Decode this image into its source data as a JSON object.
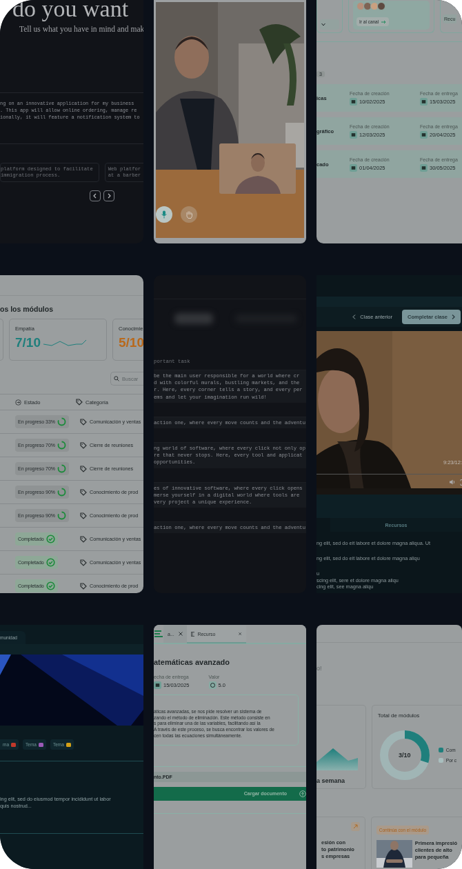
{
  "idea_panel": {
    "heading": "do you want",
    "subtitle": "Tell us what you have in mind and mak",
    "prompt_lines": [
      "ng on an innovative application for my business",
      ". This app will allow online ordering, manage re",
      "ionally, it will feature a notification system to"
    ],
    "suggestions": [
      {
        "lines": [
          "platform designed to facilitate",
          "immigration process."
        ]
      },
      {
        "lines": [
          "Web platfor",
          "at a barber"
        ]
      }
    ]
  },
  "video_call": {
    "mic_on": true,
    "hand_raised": false
  },
  "assignments_panel": {
    "channel_button": "Ir al canal",
    "resource_partial": "Recu",
    "count_badge": "3",
    "rows": [
      {
        "name": "icas",
        "created_label": "Fecha de creación",
        "created": "10/02/2025",
        "due_label": "Fecha de entrega",
        "due": "15/03/2025"
      },
      {
        "name": "gráfico",
        "created_label": "Fecha de creación",
        "created": "12/03/2025",
        "due_label": "Fecha de entrega",
        "due": "20/04/2025"
      },
      {
        "name": "cado",
        "created_label": "Fecha de creación",
        "created": "01/04/2025",
        "due_label": "Fecha de entrega",
        "due": "30/05/2025"
      }
    ]
  },
  "modules_panel": {
    "heading": "os los módulos",
    "stats": [
      {
        "label": "Empatía",
        "value": "7/10",
        "color": "#1f7f7c"
      },
      {
        "label": "Conocimie",
        "value": "5/10",
        "color": "#b8691c"
      }
    ],
    "search": {
      "placeholder": "Buscar"
    },
    "columns": [
      "Estado",
      "Categoría"
    ],
    "rows": [
      {
        "status": "En progreso 33%",
        "kind": "progress",
        "category": "Comunicación y ventas"
      },
      {
        "status": "En progreso 70%",
        "kind": "progress",
        "category": "Cierre de reuniones"
      },
      {
        "status": "En progreso 70%",
        "kind": "progress",
        "category": "Cierre de reuniones"
      },
      {
        "status": "En progreso 90%",
        "kind": "progress",
        "category": "Conocimiento de prod"
      },
      {
        "status": "En progreso 90%",
        "kind": "progress",
        "category": "Conocimiento de prod"
      },
      {
        "status": "Completado",
        "kind": "done",
        "category": "Comunicación y ventas"
      },
      {
        "status": "Completado",
        "kind": "done",
        "category": "Comunicación y ventas"
      },
      {
        "status": "Completado",
        "kind": "done",
        "category": "Conocimiento de prod"
      }
    ]
  },
  "story_panel": {
    "label": "portant task",
    "paragraphs": [
      [
        "be the main user responsible for a world where cr",
        "d with colorful murals, bustling markets, and the",
        "r. Here, every corner tells a story, and every per",
        "ems and let your imagination run wild!"
      ],
      [
        "action one, where every move counts and the adventu"
      ],
      [
        "ng world of software, where every click not only op",
        "re that never stops. Here, every tool and applicat",
        "opportunities."
      ],
      [
        "es of innovative software, where every click opens",
        "merse yourself in a digital world where tools are",
        "very project a unique experience."
      ],
      [
        "action one, where every move counts and the adventu"
      ]
    ]
  },
  "lesson_panel": {
    "prev_button": "Clase anterior",
    "next_button": "Completar clase",
    "time": "9:23/12:",
    "tab": "Recursos",
    "lines": [
      "ng elit, sed do eit labore et dolore magna aliqua. Ut",
      "ng elit, sed do eit labore et dolore magna aliqu",
      "u",
      "scing elit, sere et dolore magna aliqu",
      "cing elit, see magna aliqu"
    ]
  },
  "community_panel": {
    "tab": "munidad",
    "tags": [
      {
        "label": "ma",
        "color": "#c0392b"
      },
      {
        "label": "Tema",
        "color": "#9b59b6"
      },
      {
        "label": "Tema",
        "color": "#d4a017"
      }
    ],
    "text_lines": [
      "ing elit, sed do eiusmod tempor incididunt ut labor",
      "quis nostrud..."
    ]
  },
  "task_panel": {
    "tabs": [
      {
        "label": "a...",
        "selected": false
      },
      {
        "label": "Recurso",
        "selected": true
      }
    ],
    "title": "atemáticas avanzado",
    "fields": [
      {
        "label": "echa de entrega",
        "value": "15/03/2025",
        "kind": "date"
      },
      {
        "label": "Valor",
        "value": "5.0",
        "kind": "score"
      }
    ],
    "description": [
      "áticas avanzadas, se nos pide resolver un sistema de",
      "zando el método de eliminación. Este método consiste en",
      "s para eliminar una de las variables, facilitando así la",
      "A través de este proceso, se busca encontrar los valores de",
      "cen todas las ecuaciones simultáneamente."
    ],
    "file": "nto.PDF",
    "upload_button": "Cargar documento"
  },
  "dashboard_panel": {
    "greeting": "o!",
    "chart_caption": "a semana",
    "total_title": "Total de módulos",
    "donut": {
      "label": "3/10",
      "level": 0.3
    },
    "legend": [
      {
        "label": "Com",
        "color": "#1f7f7c"
      },
      {
        "label": "Por c",
        "color": "#a9bfbf"
      }
    ],
    "cards": [
      {
        "kind": "link",
        "lines": [
          "esión con",
          "to patrimonio",
          "s empresas"
        ]
      },
      {
        "kind": "module",
        "badge": "Continúa con el módulo",
        "lines": [
          "Primera impresió",
          "clientes de alto",
          "para pequeña"
        ]
      }
    ]
  }
}
